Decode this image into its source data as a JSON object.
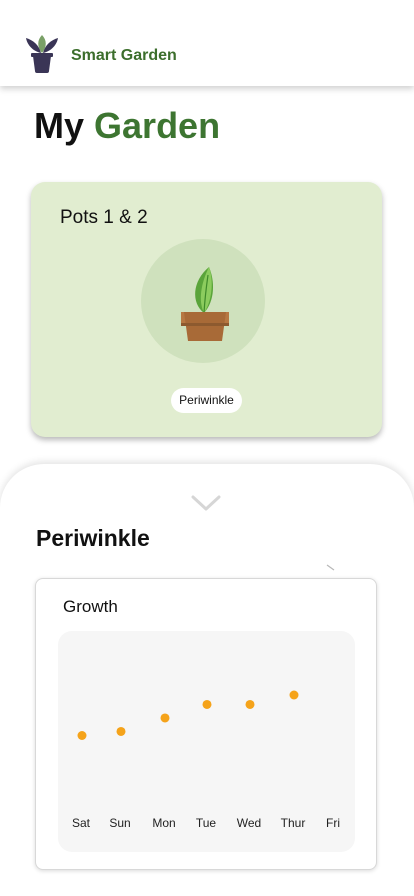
{
  "header": {
    "app_name": "Smart Garden",
    "logo_icon": "plant-pot-logo-icon"
  },
  "page": {
    "title_prefix": "My",
    "title_accent": "Garden"
  },
  "pot_card": {
    "title": "Pots 1 & 2",
    "plant_name": "Periwinkle",
    "icon": "potted-plant-icon"
  },
  "sheet": {
    "collapse_icon": "chevron-down-icon",
    "title": "Periwinkle"
  },
  "growth": {
    "title": "Growth"
  },
  "colors": {
    "brand_green": "#3c6e2c",
    "card_bg": "#e1edd0",
    "point_color": "#f5a31a"
  },
  "chart_data": {
    "type": "scatter",
    "categories": [
      "Sat",
      "Sun",
      "Mon",
      "Tue",
      "Wed",
      "Thur",
      "Fri"
    ],
    "values": [
      5.0,
      5.3,
      6.3,
      7.3,
      7.3,
      8.0,
      null
    ],
    "ylim": [
      0,
      12
    ],
    "title": "Growth",
    "xlabel": "",
    "ylabel": "",
    "grid": false
  }
}
